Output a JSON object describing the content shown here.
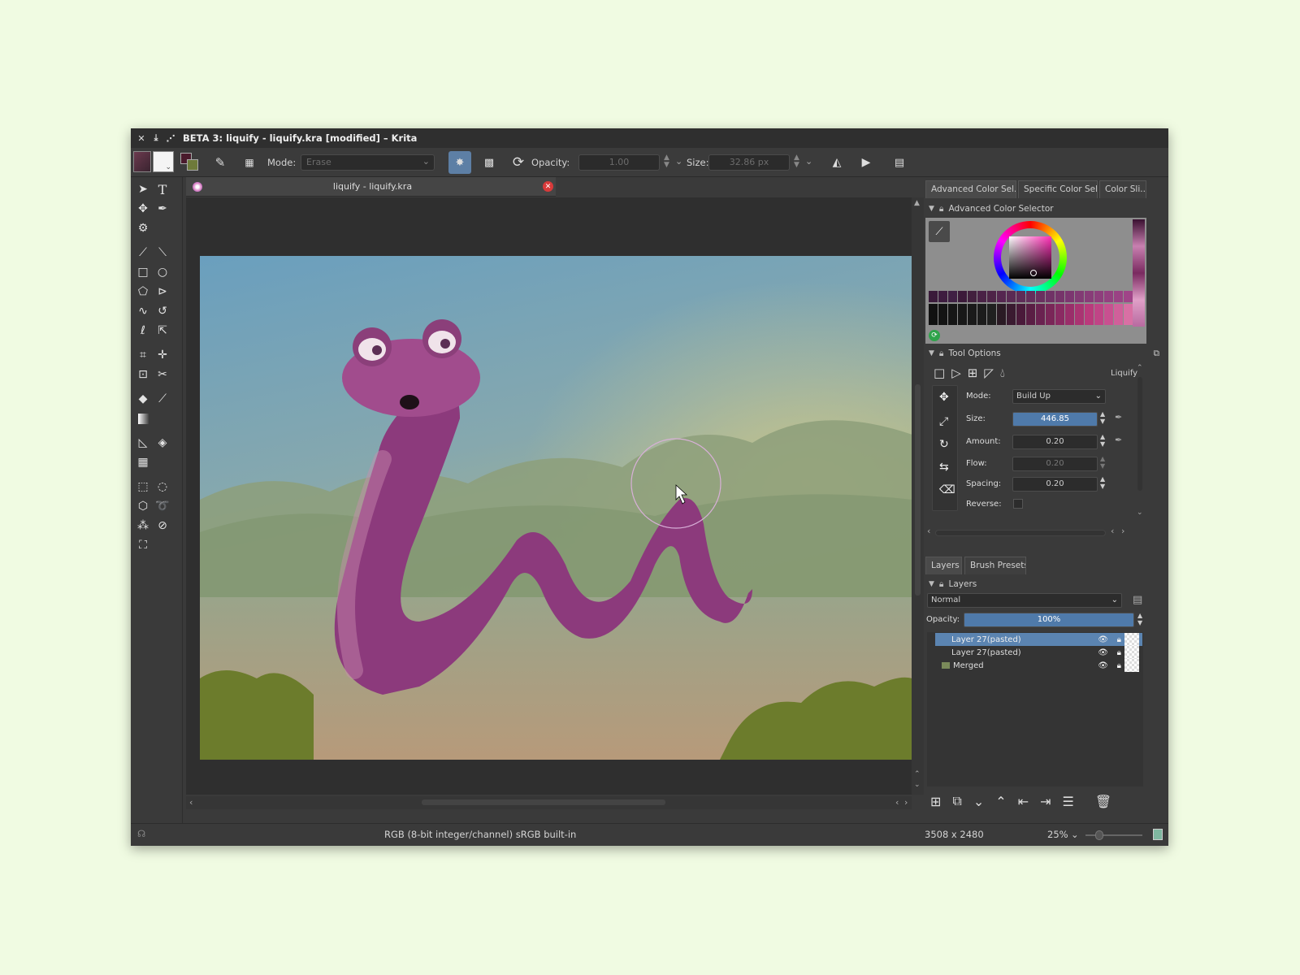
{
  "window": {
    "title": "BETA 3: liquify - liquify.kra [modified] – Krita",
    "controls": [
      "✕",
      "⤓",
      "⋰"
    ]
  },
  "toolbar": {
    "mode_label": "Mode:",
    "mode_value": "Erase",
    "opacity_label": "Opacity:",
    "opacity_value": "1.00",
    "size_label": "Size:",
    "size_value": "32.86 px"
  },
  "document": {
    "tab_title": "liquify - liquify.kra"
  },
  "color_panel": {
    "tabs": [
      "Advanced Color Sel...",
      "Specific Color Sel...",
      "Color Sli..."
    ],
    "header": "Advanced Color Selector",
    "accent_hue": "#ff2fb6"
  },
  "tool_options": {
    "header": "Tool Options",
    "tool_name": "Liquify",
    "mode_label": "Mode:",
    "mode_value": "Build Up",
    "size_label": "Size:",
    "size_value": "446.85",
    "amount_label": "Amount:",
    "amount_value": "0.20",
    "flow_label": "Flow:",
    "flow_value": "0.20",
    "spacing_label": "Spacing:",
    "spacing_value": "0.20",
    "reverse_label": "Reverse:"
  },
  "layers_panel": {
    "tabs": [
      "Layers",
      "Brush Presets"
    ],
    "header": "Layers",
    "blend_mode": "Normal",
    "opacity_label": "Opacity:",
    "opacity_value": "100%",
    "layers": [
      {
        "name": "Layer 27(pasted)",
        "selected": true
      },
      {
        "name": "Layer 27(pasted)",
        "selected": false
      },
      {
        "name": "Merged",
        "selected": false
      }
    ]
  },
  "statusbar": {
    "color_space": "RGB (8-bit integer/channel)  sRGB built-in",
    "dimensions": "3508 x 2480",
    "zoom": "25%"
  }
}
